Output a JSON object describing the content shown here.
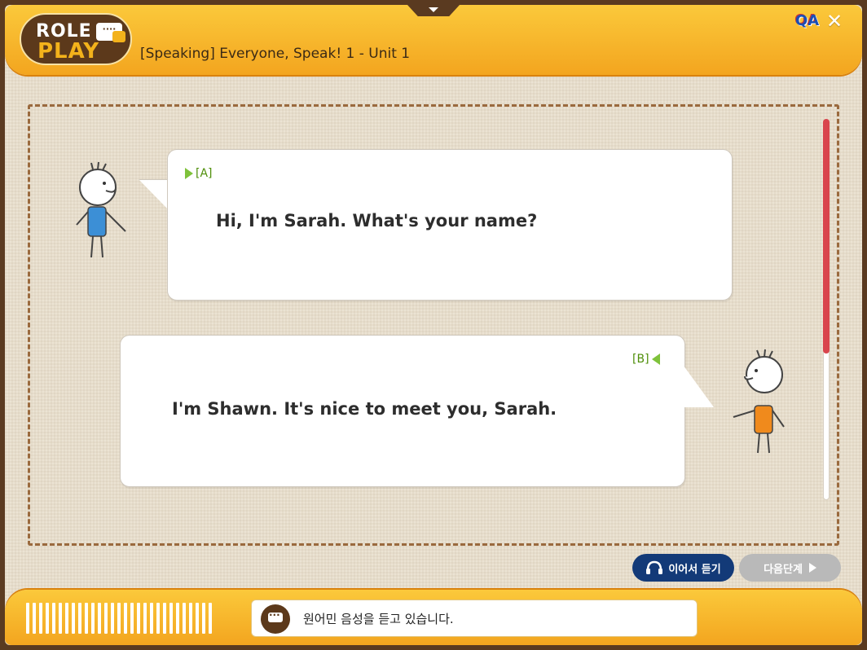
{
  "header": {
    "logo_line1": "ROLE",
    "logo_line2": "PLAY",
    "title": "[Speaking] Everyone, Speak! 1 - Unit 1",
    "qa_label": "QA",
    "close_symbol": "✕"
  },
  "dialogue": [
    {
      "speaker": "[A]",
      "text": "Hi, I'm Sarah. What's your name?"
    },
    {
      "speaker": "[B]",
      "text": "I'm Shawn. It's nice to meet you, Sarah."
    }
  ],
  "controls": {
    "listen_button": "이어서 듣기",
    "next_button": "다음단계"
  },
  "footer": {
    "status_text": "원어민 음성을 듣고 있습니다."
  },
  "colors": {
    "accent": "#f3a51f",
    "brown": "#5c391b",
    "listen_button": "#133a78",
    "next_button": "#b9b9b9",
    "scroll_thumb": "#d9454d",
    "speaker_tag": "#4f8f0a"
  }
}
